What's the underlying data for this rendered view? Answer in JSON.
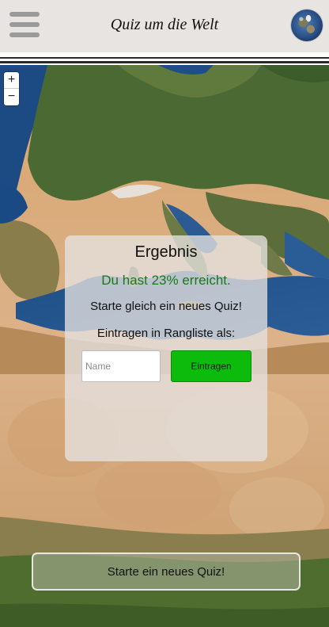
{
  "header": {
    "title": "Quiz um die Welt",
    "menu_icon": "hamburger-menu-icon",
    "globe_icon": "globe-icon"
  },
  "map": {
    "zoom_in_label": "+",
    "zoom_out_label": "−"
  },
  "result_panel": {
    "title": "Ergebnis",
    "result": "Du hast 23% erreicht.",
    "restart_hint": "Starte gleich ein neues Quiz!",
    "ranking_label": "Eintragen in Rangliste als:",
    "name_placeholder": "Name",
    "name_value": "",
    "submit_label": "Eintragen"
  },
  "new_quiz_button": {
    "label": "Starte ein neues Quiz!"
  },
  "colors": {
    "header_bg": "#e8e4e2",
    "result_green": "#167a16",
    "submit_green": "#0cbb0c"
  }
}
